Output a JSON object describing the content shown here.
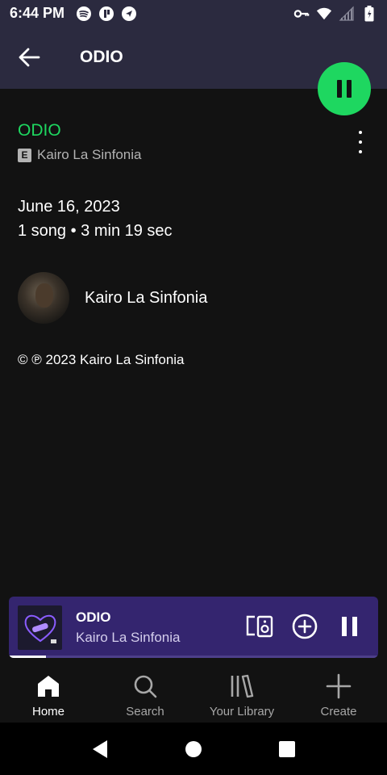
{
  "status_bar": {
    "time": "6:44 PM",
    "left_icons": [
      "spotify-icon",
      "app-icon",
      "location-icon"
    ],
    "right_icons": [
      "vpn-key-icon",
      "wifi-icon",
      "signal-icon",
      "battery-icon"
    ]
  },
  "header": {
    "title": "ODIO",
    "back_icon": "arrow-back-icon"
  },
  "playback": {
    "state_icon": "pause-icon",
    "accent_color": "#1ed760"
  },
  "album": {
    "name": "ODIO",
    "explicit_badge": "E",
    "artist": "Kairo La Sinfonia",
    "release_date": "June 16, 2023",
    "song_info": "1 song • 3 min 19 sec",
    "copyright": "© ℗ 2023 Kairo La Sinfonia"
  },
  "artist_row": {
    "name": "Kairo La Sinfonia"
  },
  "mini_player": {
    "title": "ODIO",
    "artist": "Kairo La Sinfonia",
    "background_color": "#34256f",
    "progress_fraction": 0.1,
    "controls": [
      "connect-device-icon",
      "add-circle-icon",
      "pause-icon"
    ]
  },
  "bottom_nav": {
    "items": [
      {
        "label": "Home",
        "icon": "home-icon",
        "active": true
      },
      {
        "label": "Search",
        "icon": "search-icon",
        "active": false
      },
      {
        "label": "Your Library",
        "icon": "library-icon",
        "active": false
      },
      {
        "label": "Create",
        "icon": "plus-icon",
        "active": false
      }
    ]
  },
  "system_nav": [
    "back-triangle-icon",
    "home-circle-icon",
    "recents-square-icon"
  ]
}
